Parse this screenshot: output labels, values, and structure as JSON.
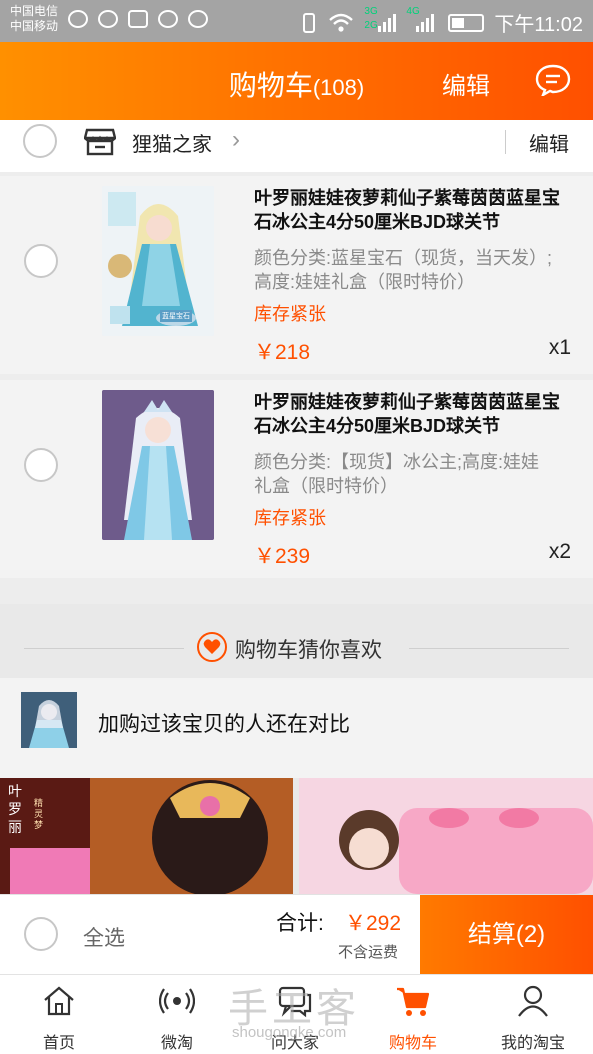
{
  "status_bar": {
    "carrier1": "中国电信",
    "carrier2": "中国移动",
    "net_3g": "3G",
    "net_2g": "2G",
    "net_4g": "4G",
    "time": "下午11:02"
  },
  "nav": {
    "title": "购物车",
    "count": "(108)",
    "edit": "编辑",
    "message_icon": "message-icon"
  },
  "shop": {
    "name": "狸猫之家",
    "edit": "编辑"
  },
  "items": [
    {
      "title": "叶罗丽娃娃夜萝莉仙子紫莓茵茵蓝星宝石冰公主4分50厘米BJD球关节",
      "spec": "颜色分类:蓝星宝石（现货，当天发）;高度:娃娃礼盒（限时特价）",
      "stock": "库存紧张",
      "price": "￥218",
      "qty": "x1",
      "thumb_tag": "蓝星宝石"
    },
    {
      "title": "叶罗丽娃娃夜萝莉仙子紫莓茵茵蓝星宝石冰公主4分50厘米BJD球关节",
      "spec": "颜色分类:【现货】冰公主;高度:娃娃礼盒（限时特价）",
      "stock": "库存紧张",
      "price": "￥239",
      "qty": "x2",
      "thumb_tag": ""
    }
  ],
  "guess": {
    "title": "购物车猜你喜欢",
    "compare_text": "加购过该宝贝的人还在对比",
    "rec_left_text": "叶罗丽",
    "rec_left_sub": "精灵梦"
  },
  "checkout": {
    "select_all": "全选",
    "total_label": "合计:",
    "total_value": "￥292",
    "shipping_note": "不含运费",
    "pay_button": "结算(2)"
  },
  "tabs": [
    {
      "label": "首页",
      "icon": "home-icon"
    },
    {
      "label": "微淘",
      "icon": "broadcast-icon"
    },
    {
      "label": "问大家",
      "icon": "chat-icon"
    },
    {
      "label": "购物车",
      "icon": "cart-icon",
      "active": true
    },
    {
      "label": "我的淘宝",
      "icon": "person-icon"
    }
  ],
  "watermark": {
    "text": "手工客",
    "url": "shougongke.com"
  },
  "colors": {
    "accent": "#ff5000",
    "nav_gradient_start": "#ff9000",
    "nav_gradient_end": "#ff5000"
  }
}
